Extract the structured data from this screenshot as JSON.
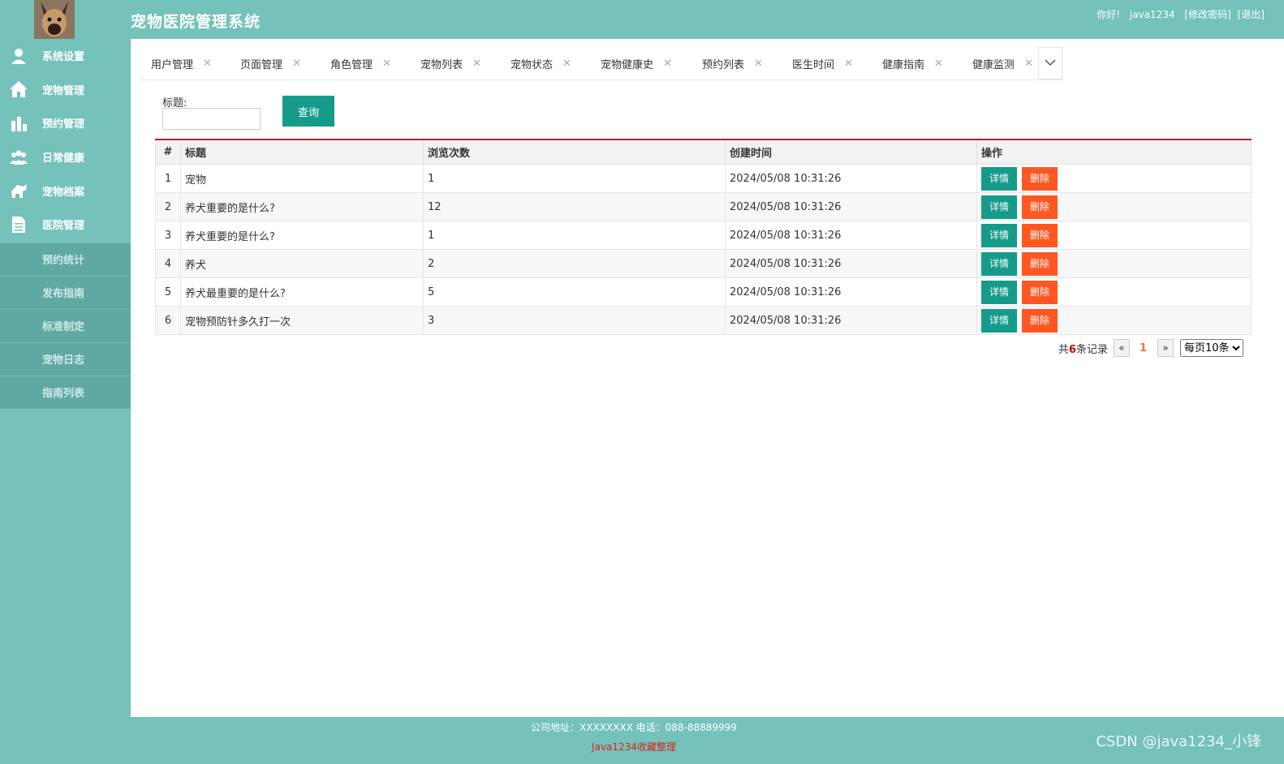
{
  "header": {
    "title": "宠物医院管理系统",
    "greeting": "你好!",
    "username": "java1234",
    "change_password": "[修改密码]",
    "logout": "[退出]"
  },
  "sidebar": {
    "items": [
      {
        "label": "系统设置",
        "icon": "user-icon"
      },
      {
        "label": "宠物管理",
        "icon": "home-icon"
      },
      {
        "label": "预约管理",
        "icon": "bar-chart-icon"
      },
      {
        "label": "日常健康",
        "icon": "group-icon"
      },
      {
        "label": "宠物档案",
        "icon": "pet-icon"
      },
      {
        "label": "医院管理",
        "icon": "document-icon"
      }
    ],
    "sub_items": [
      "预约统计",
      "发布指南",
      "标准制定",
      "宠物日志",
      "指南列表"
    ]
  },
  "tabs": [
    "用户管理",
    "页面管理",
    "角色管理",
    "宠物列表",
    "宠物状态",
    "宠物健康史",
    "预约列表",
    "医生时间",
    "健康指南",
    "健康监测"
  ],
  "search": {
    "label": "标题:",
    "value": "",
    "button": "查询"
  },
  "table": {
    "headers": [
      "#",
      "标题",
      "浏览次数",
      "创建时间",
      "操作"
    ],
    "rows": [
      {
        "num": "1",
        "title": "宠物",
        "views": "1",
        "created": "2024/05/08 10:31:26"
      },
      {
        "num": "2",
        "title": "养犬重要的是什么?",
        "views": "12",
        "created": "2024/05/08 10:31:26"
      },
      {
        "num": "3",
        "title": "养犬重要的是什么?",
        "views": "1",
        "created": "2024/05/08 10:31:26"
      },
      {
        "num": "4",
        "title": "养犬",
        "views": "2",
        "created": "2024/05/08 10:31:26"
      },
      {
        "num": "5",
        "title": "养犬最重要的是什么?",
        "views": "5",
        "created": "2024/05/08 10:31:26"
      },
      {
        "num": "6",
        "title": "宠物预防针多久打一次",
        "views": "3",
        "created": "2024/05/08 10:31:26"
      }
    ],
    "detail_label": "详情",
    "delete_label": "删除"
  },
  "pagination": {
    "total_prefix": "共",
    "total_count": "6",
    "total_suffix": "条记录",
    "prev": "«",
    "current": "1",
    "next": "»",
    "page_size": "每页10条"
  },
  "footer": {
    "address": "公司地址：XXXXXXXX 电话：088-88889999",
    "credit": "Java1234收藏整理"
  },
  "watermark": "CSDN @java1234_小锋",
  "colors": {
    "theme": "#74c2ba",
    "primary_button": "#169b8b",
    "delete_button": "#ff5722",
    "table_accent": "#b5232c"
  }
}
